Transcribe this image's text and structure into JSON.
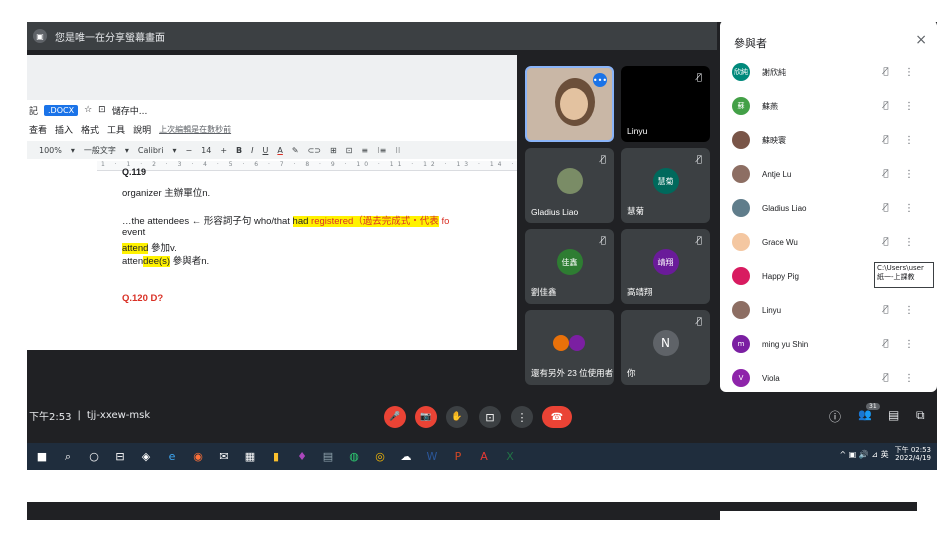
{
  "banner": {
    "text": "您是唯一在分享螢幕畫面"
  },
  "doc": {
    "title_char": "記",
    "docx_badge": ".DOCX",
    "star": "☆",
    "status": "儲存中...",
    "menus": [
      "查看",
      "插入",
      "格式",
      "工具",
      "說明"
    ],
    "last_edit": "上次編輯是在數秒前",
    "toolbar": [
      "100%",
      "▾",
      "一般文字",
      "▾",
      "Calibri",
      "▾",
      "−",
      "14",
      "+",
      "B",
      "I",
      "U",
      "A",
      "✎",
      "⊂⊃",
      "⊞",
      "⊡",
      "≡",
      "⁝≡",
      "⁝⁝"
    ],
    "ruler": "1 · 1 · 2 · 3 · 4 · 5 · 6 · 7 · 8 · 9 · 10 · 11 · 12 · 13 · 14 · 15 · 16",
    "top_partial": "Q.119",
    "line1": "organizer 主辦單位n.",
    "line2_a": "…the attendees ← 形容詞子句 who/that ",
    "line2_b": "had ",
    "line2_c": "registered",
    "line2_d": "（過去完成式・代表",
    "line2_e": "fo",
    "line3": "event",
    "line4_a": "attend",
    "line4_b": " 參加v.",
    "line5_a": "atten",
    "line5_b": "dee(s)",
    "line5_c": " 參與者n.",
    "line6": "Q.120 D?"
  },
  "meeting": {
    "time": "下午2:53",
    "separator": "|",
    "code": "tjj-xxew-msk"
  },
  "tiles": [
    {
      "name": "",
      "initials": ""
    },
    {
      "name": "Linyu",
      "initials": ""
    },
    {
      "name": "Gladius Liao",
      "initials": ""
    },
    {
      "name": "慧菊",
      "initials": "慧菊"
    },
    {
      "name": "劉佳鑫",
      "initials": "佳鑫"
    },
    {
      "name": "高靖翔",
      "initials": "靖翔"
    },
    {
      "name": "還有另外 23 位使用者",
      "initials": ""
    },
    {
      "name": "你",
      "initials": "N"
    }
  ],
  "controls": {
    "mic": "🎤",
    "cam": "📷",
    "hand": "✋",
    "present": "⊡",
    "more": "⋮",
    "end": "☎"
  },
  "right_controls": {
    "info": "ⓘ",
    "people": "👥",
    "count": "31",
    "chat": "▤",
    "activities": "⧉"
  },
  "panel": {
    "title": "參與者",
    "close": "×",
    "participants": [
      {
        "name": "謝欣純",
        "initials": "欣純",
        "color": "#00897b"
      },
      {
        "name": "蘇燕",
        "initials": "蘇",
        "color": "#43a047"
      },
      {
        "name": "蘇映寰",
        "initials": "",
        "color": "#795548"
      },
      {
        "name": "Antje Lu",
        "initials": "",
        "color": "#8d6e63"
      },
      {
        "name": "Gladius Liao",
        "initials": "",
        "color": "#607d8b"
      },
      {
        "name": "Grace Wu",
        "initials": "",
        "color": "#f4c7a1"
      },
      {
        "name": "Happy Pig",
        "initials": "",
        "color": "#d81b60"
      },
      {
        "name": "Linyu",
        "initials": "",
        "color": "#8d6e63"
      },
      {
        "name": "ming yu Shin",
        "initials": "m",
        "color": "#7b1fa2"
      },
      {
        "name": "Viola",
        "initials": "V",
        "color": "#8e24aa"
      }
    ],
    "mic_icon": "🎙̸",
    "more_icon": "⋮"
  },
  "tooltip": {
    "line1": "C:\\Users\\user",
    "line2": "紙一-上課教"
  },
  "taskbar": {
    "items": [
      "■",
      "⌕",
      "○",
      "⊟",
      "◈",
      "e",
      "◉",
      "✉",
      "▦",
      "▮",
      "♦",
      "▤",
      "◍",
      "◎",
      "☁",
      "W",
      "P",
      "A",
      "X"
    ],
    "tray": "^ ▣ 🔊 ⊿ 英",
    "time": "下午 02:53",
    "date": "2022/4/19"
  }
}
